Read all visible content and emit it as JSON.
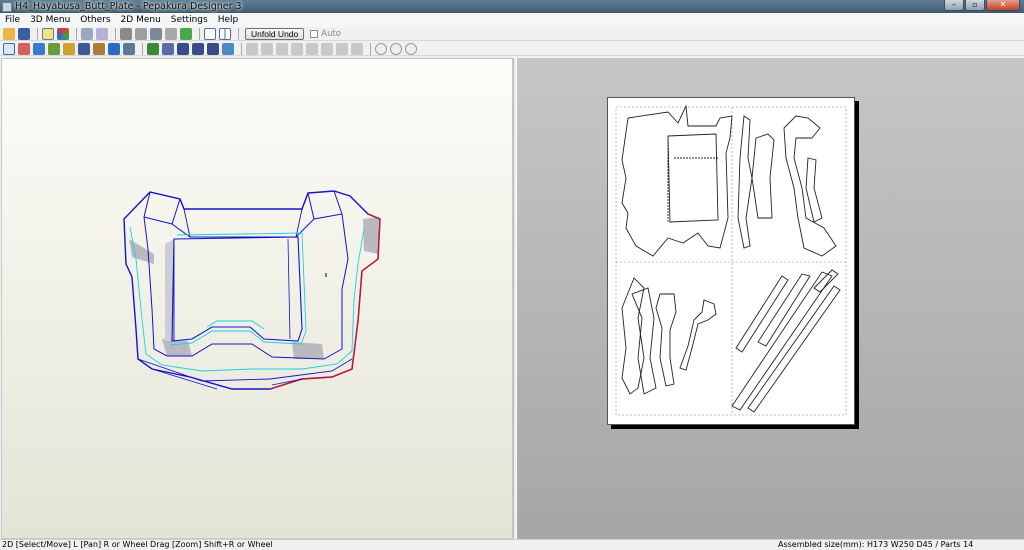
{
  "window": {
    "title": "H4_Hayabusa_Butt_Plate - Pepakura Designer 3",
    "minimize_glyph": "–",
    "maximize_glyph": "▫",
    "close_glyph": "✕"
  },
  "menu": {
    "items": [
      "File",
      "3D Menu",
      "Others",
      "2D Menu",
      "Settings",
      "Help"
    ]
  },
  "toolbar": {
    "unfold_undo_label": "Unfold Undo",
    "auto_label": "Auto",
    "row1_icons": [
      "open-folder-icon",
      "save-icon",
      "lightbulb-icon",
      "texture-icon",
      "unfold-icon",
      "fold-icon",
      "pencil-icon",
      "cylinder-icon",
      "anchor-icon",
      "part-icon",
      "check-icon",
      "single-view-icon",
      "dual-view-icon"
    ],
    "row2_icons": [
      "select-icon",
      "cut-icon",
      "flaps-icon",
      "tool-icon",
      "tool-icon",
      "tool-icon",
      "tool-icon",
      "tool-icon",
      "tool-icon",
      "tool-icon",
      "tool-icon",
      "tool-icon",
      "tool-icon",
      "tool-icon",
      "tool-icon",
      "align-icon",
      "align-icon",
      "align-icon",
      "align-icon",
      "align-icon",
      "align-icon",
      "align-icon",
      "align-icon",
      "rotate-icon",
      "rotate-icon",
      "rotate-icon"
    ]
  },
  "colors": {
    "edge_blue": "#1414c8",
    "edge_cyan": "#19d2dc",
    "edge_red": "#d2141e",
    "face_gray": "#b9b9bf"
  },
  "status": {
    "left": "2D [Select/Move] L [Pan] R or Wheel Drag [Zoom] Shift+R or Wheel",
    "right": "Assembled size(mm): H173 W250 D45 / Parts 14"
  }
}
